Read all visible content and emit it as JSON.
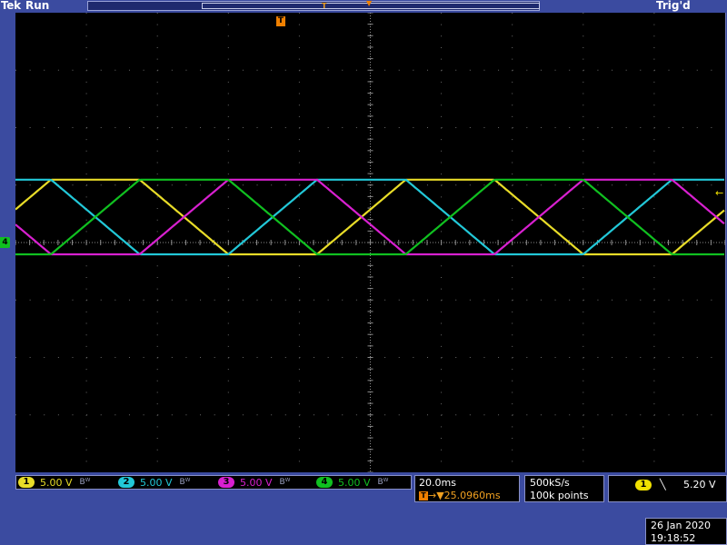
{
  "header": {
    "brand": "Tek",
    "run_status": "Run",
    "trigger_status": "Trig'd",
    "record_trigger_marker": "T"
  },
  "waveform_area": {
    "ch4_ground_marker": "4",
    "trigger_position_marker": "T",
    "trigger_level_arrow": "←",
    "trigger_position_top": "▼",
    "colors": {
      "ch1": "#e8dc28",
      "ch2": "#22c8d8",
      "ch3": "#d820d0",
      "ch4": "#10c020",
      "grid": "#6a6a6a",
      "background": "#000000"
    },
    "waveform": {
      "type": "trapezoid",
      "period_ms": 100,
      "rise_ms": 25,
      "high_ms": 25,
      "fall_ms": 25,
      "low_ms": 25,
      "high_v": 5,
      "low_v": -1.5,
      "ch1_phase_ms": 0,
      "ch2_phase_ms": 25,
      "ch3_phase_ms": 50,
      "ch4_phase_ms": 75
    }
  },
  "channels": [
    {
      "id": "1",
      "scale": "5.00 V",
      "color": "#e8dc28",
      "bw_icon": "bw-limit-icon"
    },
    {
      "id": "2",
      "scale": "5.00 V",
      "color": "#22c8d8",
      "bw_icon": "bw-limit-icon"
    },
    {
      "id": "3",
      "scale": "5.00 V",
      "color": "#d820d0",
      "bw_icon": "bw-limit-icon"
    },
    {
      "id": "4",
      "scale": "5.00 V",
      "color": "#10c020",
      "bw_icon": "bw-limit-icon"
    }
  ],
  "bw_symbol": "Bᵂ",
  "timebase": {
    "scale": "20.0ms",
    "delay_tag": "T",
    "delay": "→▼25.0960ms"
  },
  "acquisition": {
    "sample_rate": "500kS/s",
    "record_length": "100k points"
  },
  "trigger": {
    "source": "1",
    "slope": "╲",
    "level": "5.20 V"
  },
  "datetime": {
    "date": "26 Jan  2020",
    "time": "19:18:52"
  }
}
